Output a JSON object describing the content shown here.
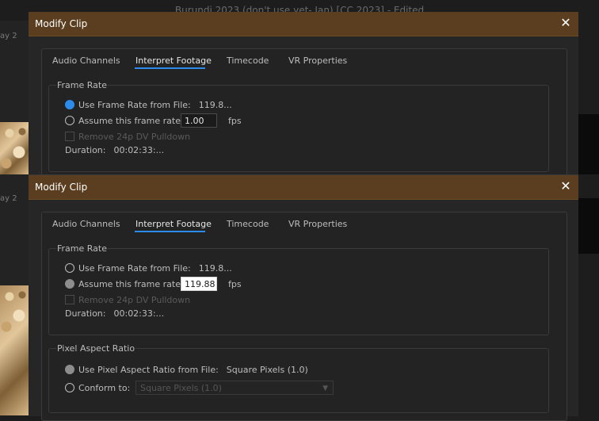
{
  "app": {
    "window_title": "Burundi 2023 (don't use yet- Jan) [CC 2023] - Edited",
    "side_tab_label": "ay 2"
  },
  "dialogs": [
    {
      "title": "Modify Clip",
      "close": "✕",
      "tabs": [
        "Audio Channels",
        "Interpret Footage",
        "Timecode",
        "VR Properties"
      ],
      "active_tab": "Interpret Footage",
      "frame_rate": {
        "title": "Frame Rate",
        "use_file_label": "Use Frame Rate from File:",
        "use_file_value": "119.8...",
        "assume_label": "Assume this frame rate:",
        "assume_value": "1.00",
        "unit": "fps",
        "pulldown_label": "Remove 24p DV Pulldown",
        "duration_label": "Duration:",
        "duration_value": "00:02:33:..."
      }
    },
    {
      "title": "Modify Clip",
      "close": "✕",
      "tabs": [
        "Audio Channels",
        "Interpret Footage",
        "Timecode",
        "VR Properties"
      ],
      "active_tab": "Interpret Footage",
      "frame_rate": {
        "title": "Frame Rate",
        "use_file_label": "Use Frame Rate from File:",
        "use_file_value": "119.8...",
        "assume_label": "Assume this frame rate:",
        "assume_value": "119.88",
        "unit": "fps",
        "pulldown_label": "Remove 24p DV Pulldown",
        "duration_label": "Duration:",
        "duration_value": "00:02:33:..."
      },
      "pixel_aspect": {
        "title": "Pixel Aspect Ratio",
        "use_file_label": "Use Pixel Aspect Ratio from File:",
        "use_file_value": "Square Pixels (1.0)",
        "conform_label": "Conform to:",
        "conform_value": "Square Pixels (1.0)"
      }
    }
  ],
  "colors": {
    "title_bar": "#5a3e1f",
    "accent": "#2d8ceb",
    "dialog_bg": "#262626"
  }
}
